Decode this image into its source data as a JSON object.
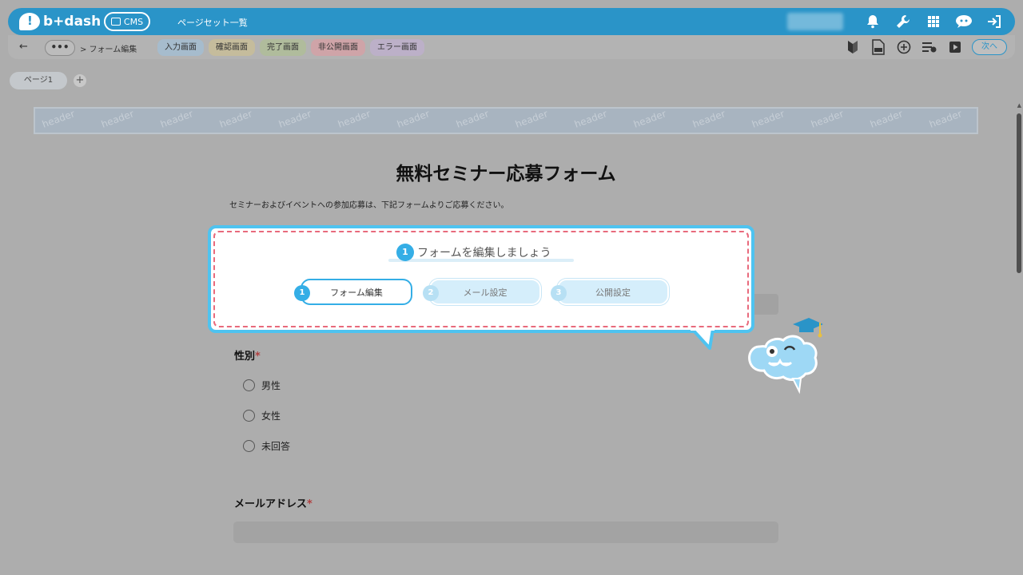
{
  "topbar": {
    "logo_text": "b+dash",
    "cms_label": "CMS",
    "nav_title": "ページセット一覧",
    "icons": [
      "bell-icon",
      "wrench-icon",
      "grid-icon",
      "chat-icon",
      "logout-icon"
    ]
  },
  "subbar": {
    "back": "←",
    "more": "•••",
    "breadcrumb": "> フォーム編集",
    "tabs": [
      {
        "label": "入力画面",
        "color": "#a6bccd"
      },
      {
        "label": "確認画面",
        "color": "#c5bc9c"
      },
      {
        "label": "完了画面",
        "color": "#b0bc9c"
      },
      {
        "label": "非公開画面",
        "color": "#cfa4a8"
      },
      {
        "label": "エラー画面",
        "color": "#bcb0c8"
      }
    ],
    "icons": [
      "beginner-mark-icon",
      "html-file-icon",
      "plus-circle-icon",
      "list-settings-icon",
      "play-icon"
    ],
    "next_label": "次へ"
  },
  "pages": {
    "tab_label": "ページ1",
    "add": "+"
  },
  "header_strip": {
    "watermark": "header"
  },
  "form": {
    "title": "無料セミナー応募フォーム",
    "description": "セミナーおよびイベントへの参加応募は、下記フォームよりご応募ください。",
    "gender_label": "性別",
    "required_mark": "*",
    "gender_options": [
      "男性",
      "女性",
      "未回答"
    ],
    "email_label": "メールアドレス"
  },
  "tutorial": {
    "heading_num": "1",
    "heading": "フォームを編集しましょう",
    "steps": [
      {
        "num": "1",
        "label": "フォーム編集",
        "active": true
      },
      {
        "num": "2",
        "label": "メール設定",
        "active": false
      },
      {
        "num": "3",
        "label": "公開設定",
        "active": false
      }
    ]
  },
  "colors": {
    "brand": "#2a94c8",
    "callout_border": "#4ec3f0",
    "dashed": "#e86a7c"
  }
}
